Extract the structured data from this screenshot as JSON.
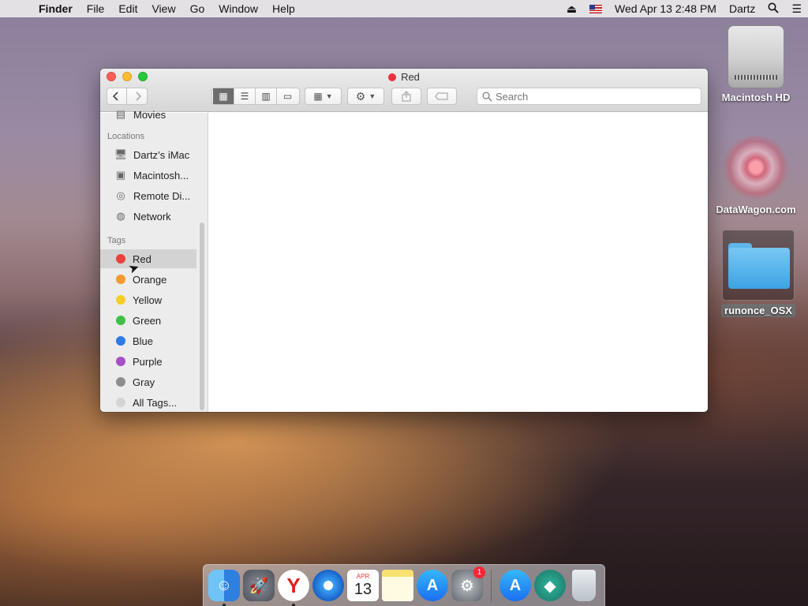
{
  "menubar": {
    "app_name": "Finder",
    "items": [
      "File",
      "Edit",
      "View",
      "Go",
      "Window",
      "Help"
    ],
    "datetime": "Wed Apr 13  2:48 PM",
    "user": "Dartz"
  },
  "window": {
    "title": "Red",
    "search_placeholder": "Search",
    "tag_color": "#e8323c"
  },
  "sidebar": {
    "cut_item": "Movies",
    "locations_heading": "Locations",
    "locations": [
      "Dartz’s iMac",
      "Macintosh...",
      "Remote Di...",
      "Network"
    ],
    "tags_heading": "Tags",
    "tags": [
      {
        "label": "Red",
        "color": "#e8423c"
      },
      {
        "label": "Orange",
        "color": "#f29a2e"
      },
      {
        "label": "Yellow",
        "color": "#f5cd2a"
      },
      {
        "label": "Green",
        "color": "#3fbf49"
      },
      {
        "label": "Blue",
        "color": "#2f7ae5"
      },
      {
        "label": "Purple",
        "color": "#a54fc7"
      },
      {
        "label": "Gray",
        "color": "#8e8e8e"
      },
      {
        "label": "All Tags...",
        "color": "#d4d4d4"
      }
    ]
  },
  "desktop": {
    "icons": [
      "Macintosh HD",
      "DataWagon.com",
      "runonce_OSX"
    ]
  },
  "dock": {
    "calendar_month": "APR",
    "calendar_day": "13",
    "badge": "1"
  }
}
